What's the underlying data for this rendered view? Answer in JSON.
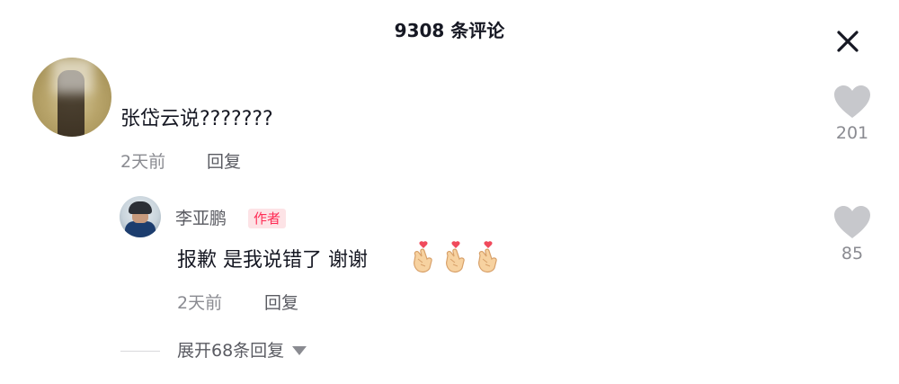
{
  "header": {
    "title": "9308 条评论"
  },
  "comments": [
    {
      "text": "张岱云说???????",
      "time": "2天前",
      "reply_label": "回复",
      "likes": "201"
    },
    {
      "username": "李亚鹏",
      "badge": "作者",
      "text": "报歉 是我说错了 谢谢",
      "emojis": [
        "finger-heart-icon",
        "finger-heart-icon",
        "finger-heart-icon"
      ],
      "time": "2天前",
      "reply_label": "回复",
      "likes": "85"
    }
  ],
  "expand": {
    "label": "展开68条回复"
  },
  "colors": {
    "accent": "#fe2c55",
    "badge_bg": "#fde3e6",
    "muted": "#8a8b91",
    "heart": "#c7c8cc"
  }
}
